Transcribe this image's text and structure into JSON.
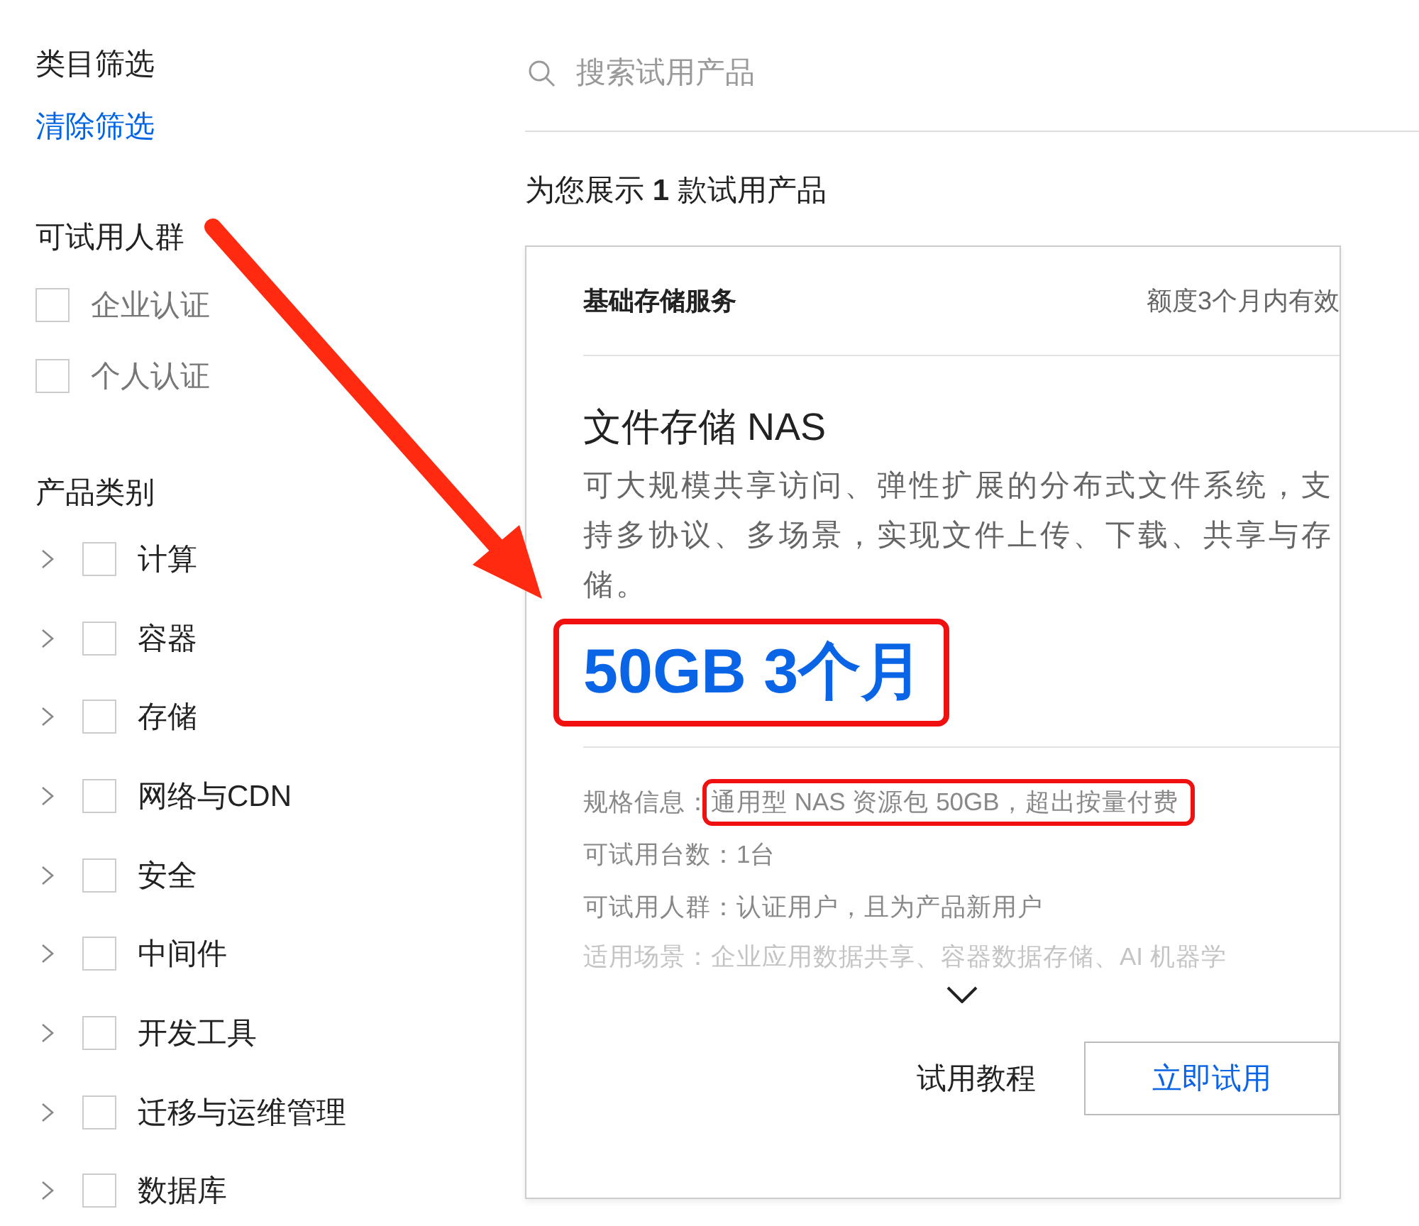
{
  "sidebar": {
    "title": "类目筛选",
    "clear_link": "清除筛选",
    "audience": {
      "title": "可试用人群",
      "options": [
        {
          "label": "企业认证",
          "checked": false
        },
        {
          "label": "个人认证",
          "checked": false
        }
      ]
    },
    "categories": {
      "title": "产品类别",
      "items": [
        {
          "label": "计算",
          "checked": false,
          "expanded": false
        },
        {
          "label": "容器",
          "checked": false,
          "expanded": false
        },
        {
          "label": "存储",
          "checked": false,
          "expanded": false
        },
        {
          "label": "网络与CDN",
          "checked": false,
          "expanded": false
        },
        {
          "label": "安全",
          "checked": false,
          "expanded": false
        },
        {
          "label": "中间件",
          "checked": false,
          "expanded": false
        },
        {
          "label": "开发工具",
          "checked": false,
          "expanded": false
        },
        {
          "label": "迁移与运维管理",
          "checked": false,
          "expanded": false
        },
        {
          "label": "数据库",
          "checked": false,
          "expanded": false
        }
      ]
    }
  },
  "search": {
    "placeholder": "搜索试用产品"
  },
  "result_summary": "为您展示 **1** 款试用产品",
  "card": {
    "category": "基础存储服务",
    "validity": "额度3个月内有效",
    "title": "文件存储 NAS",
    "description": "可大规模共享访问、弹性扩展的分布式文件系统，支持多协议、多场景，实现文件上传、下载、共享与存储。",
    "price": "50GB 3个月",
    "specs": [
      {
        "label": "规格信息：",
        "value": "通用型 NAS 资源包 50GB，超出按量付费",
        "highlighted": true,
        "faded": false
      },
      {
        "label": "可试用台数：",
        "value": "1台",
        "highlighted": false,
        "faded": false
      },
      {
        "label": "可试用人群：",
        "value": "认证用户，且为产品新用户",
        "highlighted": false,
        "faded": false
      },
      {
        "label": "适用场景：",
        "value": "企业应用数据共享、容器数据存储、AI 机器学",
        "highlighted": false,
        "faded": true
      }
    ],
    "expanded": false,
    "tutorial_link": "试用教程",
    "try_button": "立即试用"
  }
}
